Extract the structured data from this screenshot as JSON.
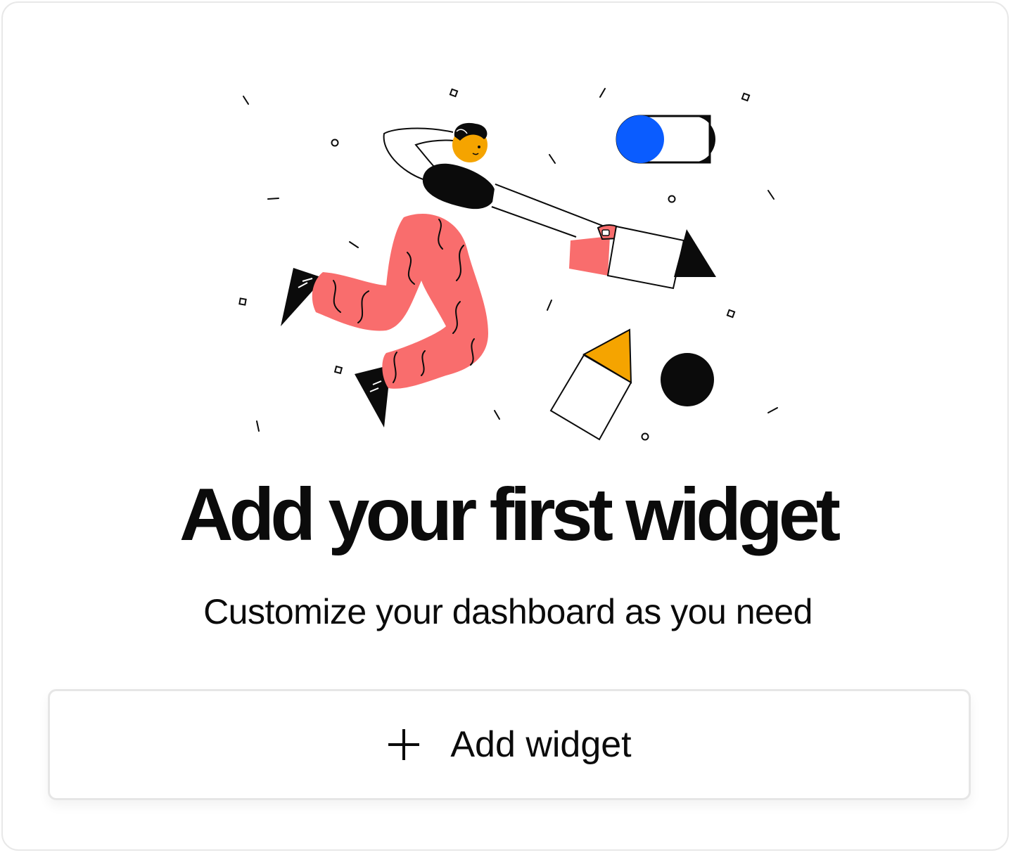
{
  "empty_state": {
    "title": "Add your first widget",
    "subtitle": "Customize your dashboard as you need",
    "button": {
      "label": "Add widget",
      "icon": "plus-icon"
    }
  },
  "colors": {
    "accent_blue": "#0a5cff",
    "coral": "#f96d6d",
    "yellow": "#f5a400",
    "ink": "#0b0b0b"
  }
}
